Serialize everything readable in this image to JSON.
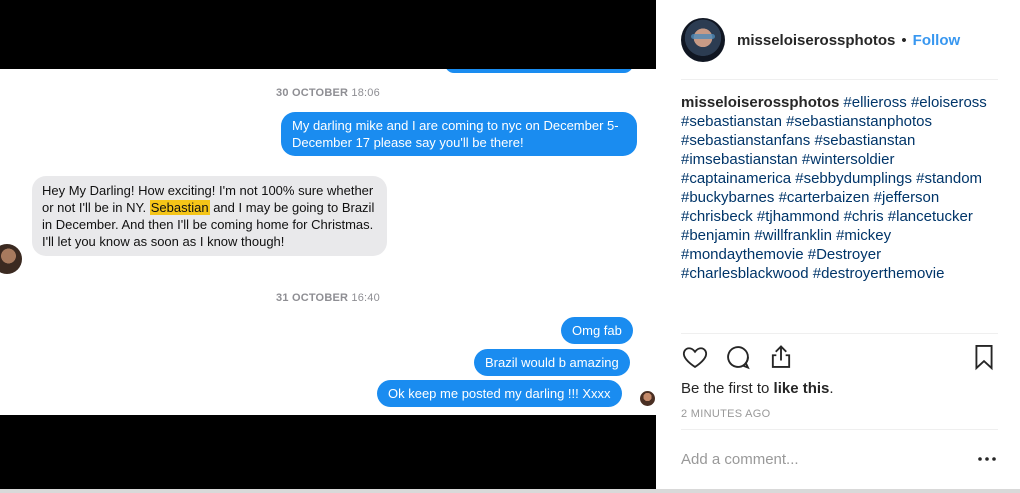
{
  "chat": {
    "timestamps": [
      {
        "date": "30 OCTOBER",
        "time": "18:06"
      },
      {
        "date": "31 OCTOBER",
        "time": "16:40"
      }
    ],
    "messages": {
      "m1": "My darling mike and I are coming to nyc on December 5-December 17 please say you'll be there!",
      "m2_before": "Hey My Darling! How exciting! I'm not 100% sure whether or not I'll be in NY. ",
      "m2_highlight": "Sebastian",
      "m2_after": " and I may be going to Brazil in December. And then I'll be coming home for Christmas. I'll let you know as soon as I know though!",
      "m3": "Omg fab",
      "m4": "Brazil would b amazing",
      "m5": "Ok keep me posted my darling !!!  Xxxx"
    }
  },
  "header": {
    "username": "misseloiserossphotos",
    "separator": "•",
    "follow_label": "Follow"
  },
  "caption": {
    "username": "misseloiserossphotos",
    "hashtags": [
      "#ellieross",
      "#eloiseross",
      "#sebastianstan",
      "#sebastianstanphotos",
      "#sebastianstanfans",
      "#sebastianstan",
      "#imsebastianstan",
      "#wintersoldier",
      "#captainamerica",
      "#sebbydumplings",
      "#standom",
      "#buckybarnes",
      "#carterbaizen",
      "#jefferson",
      "#chrisbeck",
      "#tjhammond",
      "#chris",
      "#lancetucker",
      "#benjamin",
      "#willfranklin",
      "#mickey",
      "#mondaythemovie",
      "#Destroyer",
      "#charlesblackwood",
      "#destroyerthemovie"
    ]
  },
  "actions": {
    "icons": [
      "heart-icon",
      "comment-icon",
      "share-icon",
      "bookmark-icon"
    ]
  },
  "likes": {
    "prefix": "Be the first to ",
    "bold": "like this",
    "suffix": "."
  },
  "post_time": "2 MINUTES AGO",
  "comment": {
    "placeholder": "Add a comment..."
  },
  "colors": {
    "bubble_out": "#1a8cf0",
    "bubble_in": "#e9e9eb",
    "highlight": "#f5c518",
    "follow": "#3897f0",
    "hashtag": "#003569"
  }
}
